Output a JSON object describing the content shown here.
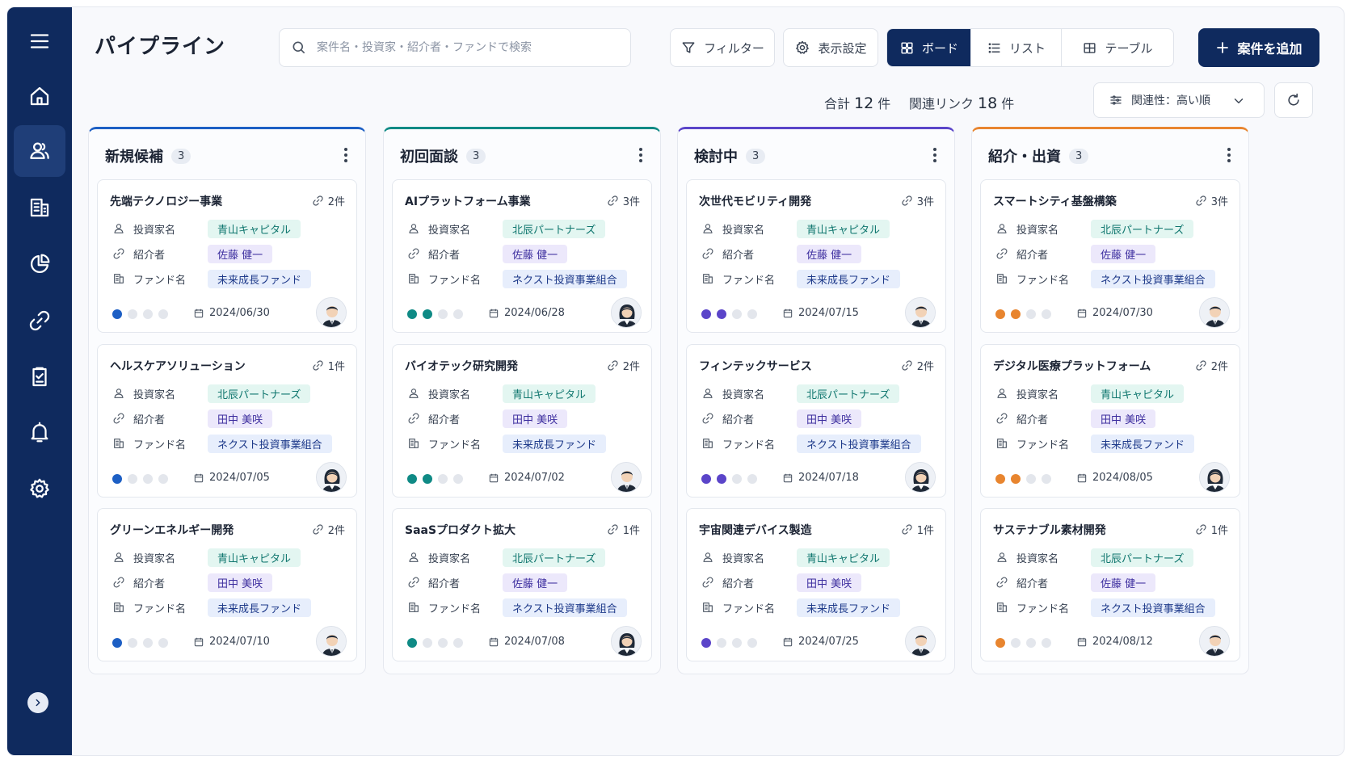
{
  "nav": {
    "items": [
      {
        "name": "home"
      },
      {
        "name": "people"
      },
      {
        "name": "building"
      },
      {
        "name": "pie-chart"
      },
      {
        "name": "link"
      },
      {
        "name": "checklist"
      },
      {
        "name": "bell"
      },
      {
        "name": "settings"
      }
    ],
    "active": "people"
  },
  "header": {
    "title": "パイプライン",
    "search_placeholder": "案件名・投資家・紹介者・ファンドで検索",
    "filter_label": "フィルター",
    "display_label": "表示設定",
    "views": [
      "ボード",
      "リスト",
      "テーブル"
    ],
    "active_view": "ボード",
    "add_label": "案件を追加"
  },
  "summary": {
    "total_prefix": "合計",
    "total_count": "12",
    "total_unit": "件",
    "links_prefix": "関連リンク",
    "links_count": "18",
    "links_unit": "件",
    "sort_label": "関連性：高い順"
  },
  "labels": {
    "investor": "投資家名",
    "introducer": "紹介者",
    "fund": "ファンド名"
  },
  "colors": {
    "primary": "#0f2a5e",
    "col1": "#1d5fc4",
    "col2": "#0f8a85",
    "col3": "#5b45c9",
    "col4": "#e8852f"
  },
  "columns": [
    {
      "title": "新規候補",
      "count": "3",
      "accent": "#1d5fc4",
      "cards": [
        {
          "title": "先端テクノロジー事業",
          "links": "2件",
          "investor": "青山キャピタル",
          "introducer": "佐藤 健一",
          "fund": "未来成長ファンド",
          "progress": 1,
          "date": "2024/06/30",
          "avatar": "male"
        },
        {
          "title": "ヘルスケアソリューション",
          "links": "1件",
          "investor": "北辰パートナーズ",
          "introducer": "田中 美咲",
          "fund": "ネクスト投資事業組合",
          "progress": 1,
          "date": "2024/07/05",
          "avatar": "female"
        },
        {
          "title": "グリーンエネルギー開発",
          "links": "2件",
          "investor": "青山キャピタル",
          "introducer": "田中 美咲",
          "fund": "未来成長ファンド",
          "progress": 1,
          "date": "2024/07/10",
          "avatar": "male"
        }
      ]
    },
    {
      "title": "初回面談",
      "count": "3",
      "accent": "#0f8a85",
      "cards": [
        {
          "title": "AIプラットフォーム事業",
          "links": "3件",
          "investor": "北辰パートナーズ",
          "introducer": "佐藤 健一",
          "fund": "ネクスト投資事業組合",
          "progress": 2,
          "date": "2024/06/28",
          "avatar": "female"
        },
        {
          "title": "バイオテック研究開発",
          "links": "2件",
          "investor": "青山キャピタル",
          "introducer": "田中 美咲",
          "fund": "未来成長ファンド",
          "progress": 2,
          "date": "2024/07/02",
          "avatar": "male"
        },
        {
          "title": "SaaSプロダクト拡大",
          "links": "1件",
          "investor": "北辰パートナーズ",
          "introducer": "佐藤 健一",
          "fund": "ネクスト投資事業組合",
          "progress": 1,
          "date": "2024/07/08",
          "avatar": "female"
        }
      ]
    },
    {
      "title": "検討中",
      "count": "3",
      "accent": "#5b45c9",
      "cards": [
        {
          "title": "次世代モビリティ開発",
          "links": "3件",
          "investor": "青山キャピタル",
          "introducer": "佐藤 健一",
          "fund": "未来成長ファンド",
          "progress": 2,
          "date": "2024/07/15",
          "avatar": "male"
        },
        {
          "title": "フィンテックサービス",
          "links": "2件",
          "investor": "北辰パートナーズ",
          "introducer": "田中 美咲",
          "fund": "ネクスト投資事業組合",
          "progress": 2,
          "date": "2024/07/18",
          "avatar": "female"
        },
        {
          "title": "宇宙関連デバイス製造",
          "links": "1件",
          "investor": "青山キャピタル",
          "introducer": "田中 美咲",
          "fund": "未来成長ファンド",
          "progress": 1,
          "date": "2024/07/25",
          "avatar": "male"
        }
      ]
    },
    {
      "title": "紹介・出資",
      "count": "3",
      "accent": "#e8852f",
      "cards": [
        {
          "title": "スマートシティ基盤構築",
          "links": "3件",
          "investor": "北辰パートナーズ",
          "introducer": "佐藤 健一",
          "fund": "ネクスト投資事業組合",
          "progress": 2,
          "date": "2024/07/30",
          "avatar": "male"
        },
        {
          "title": "デジタル医療プラットフォーム",
          "links": "2件",
          "investor": "青山キャピタル",
          "introducer": "田中 美咲",
          "fund": "未来成長ファンド",
          "progress": 2,
          "date": "2024/08/05",
          "avatar": "female"
        },
        {
          "title": "サステナブル素材開発",
          "links": "1件",
          "investor": "北辰パートナーズ",
          "introducer": "佐藤 健一",
          "fund": "ネクスト投資事業組合",
          "progress": 1,
          "date": "2024/08/12",
          "avatar": "male"
        }
      ]
    }
  ]
}
